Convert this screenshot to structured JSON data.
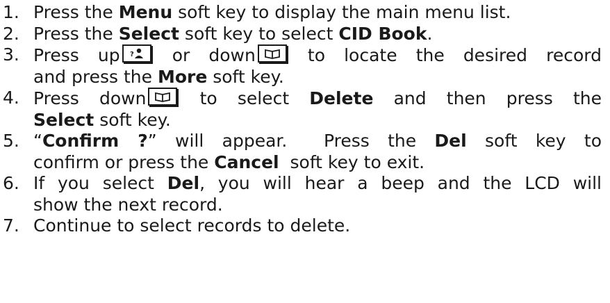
{
  "steps": [
    {
      "n": "1.",
      "a": "Press the ",
      "b": "Menu",
      "c": " soft key to display the main menu list."
    },
    {
      "n": "2.",
      "a": "Press the ",
      "b": "Select",
      "c": " soft key to select ",
      "d": "CID Book",
      "e": "."
    },
    {
      "n": "3.",
      "a": "Press up",
      "b": " or down",
      "c": " to locate the desired record",
      "d": "and press the ",
      "e": "More",
      "f": " soft key."
    },
    {
      "n": "4.",
      "a": "Press down",
      "b": " to select ",
      "c": "Delete",
      "d": " and then press the",
      "e": "Select",
      "f": " soft key."
    },
    {
      "n": "5.",
      "a": "“",
      "b": "Confirm ?",
      "c": "” will appear.  Press the ",
      "d": "Del",
      "e": " soft key to",
      "f": "confirm or press the ",
      "g": "Cancel",
      "h": "  soft key to exit."
    },
    {
      "n": "6.",
      "a": "If you select ",
      "b": "Del",
      "c": ", you will hear a beep and the LCD will",
      "d": "show the next record."
    },
    {
      "n": "7.",
      "a": "Continue to select records to delete."
    }
  ],
  "icons": {
    "up": "caller-id-up-key-icon",
    "down": "phonebook-down-key-icon"
  }
}
